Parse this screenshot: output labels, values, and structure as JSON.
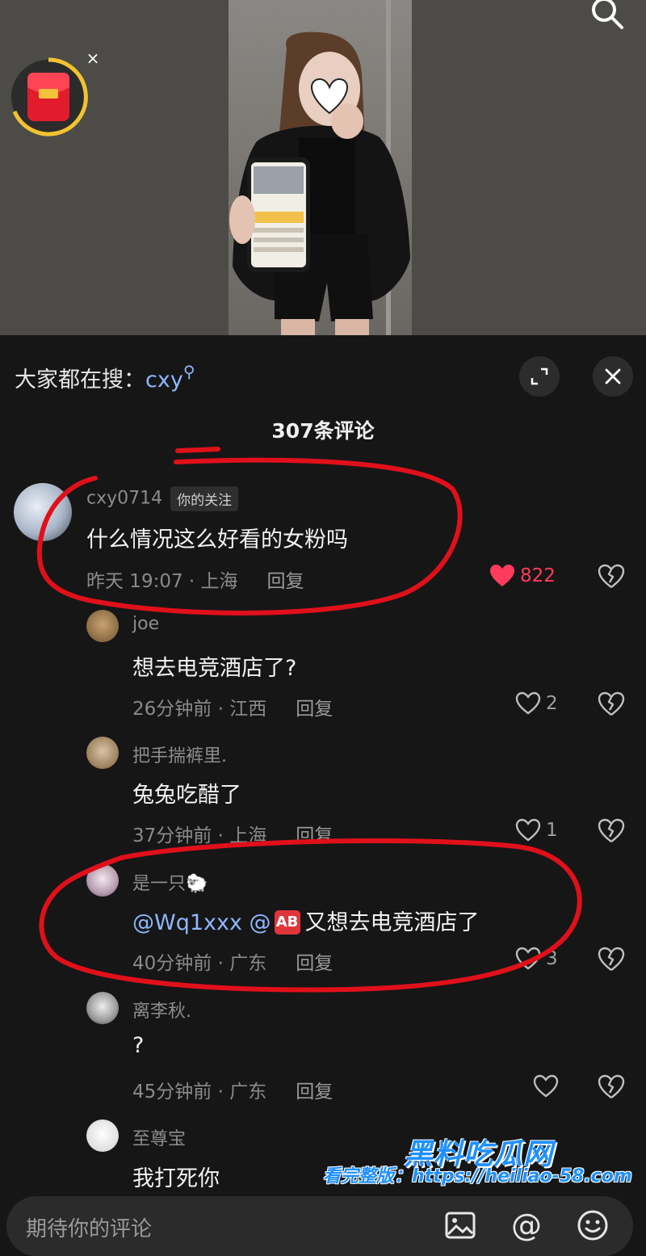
{
  "video": {
    "search_icon": "search-icon",
    "redpack_icon": "red-envelope-icon",
    "redpack_close": "×"
  },
  "panel": {
    "search_hint_prefix": "大家都在搜：",
    "search_hint_term": "cxy",
    "comment_count_title": "307条评论"
  },
  "comments": [
    {
      "user": "cxy0714",
      "tag": "你的关注",
      "text": "什么情况这么好看的女粉吗",
      "meta": "昨天 19:07 · 上海",
      "reply_label": "回复",
      "likes": "822",
      "liked": true
    },
    {
      "user": "joe",
      "text": "想去电竞酒店了?",
      "meta": "26分钟前 · 江西",
      "reply_label": "回复",
      "likes": "2"
    },
    {
      "user": "把手揣裤里.",
      "text": "兔兔吃醋了",
      "meta": "37分钟前 · 上海",
      "reply_label": "回复",
      "likes": "1"
    },
    {
      "user": "是一只🐑",
      "mention1": "@Wq1xxx",
      "mention2": "@",
      "badge": "AB",
      "text_rest": "又想去电竞酒店了",
      "meta": "40分钟前 · 广东",
      "reply_label": "回复",
      "likes": "3"
    },
    {
      "user": "离李秋.",
      "text": "?",
      "meta": "45分钟前 · 广东",
      "reply_label": "回复",
      "likes": ""
    },
    {
      "user": "至尊宝",
      "text": "我打死你"
    }
  ],
  "input": {
    "placeholder": "期待你的评论"
  },
  "watermark": {
    "brand": "黑料吃瓜网",
    "text": "看完整版：https://heiliao-58.com"
  },
  "colors": {
    "accent_link": "#8fb6ff",
    "like_red": "#ff3b5c",
    "annotation_red": "#e0101a"
  }
}
